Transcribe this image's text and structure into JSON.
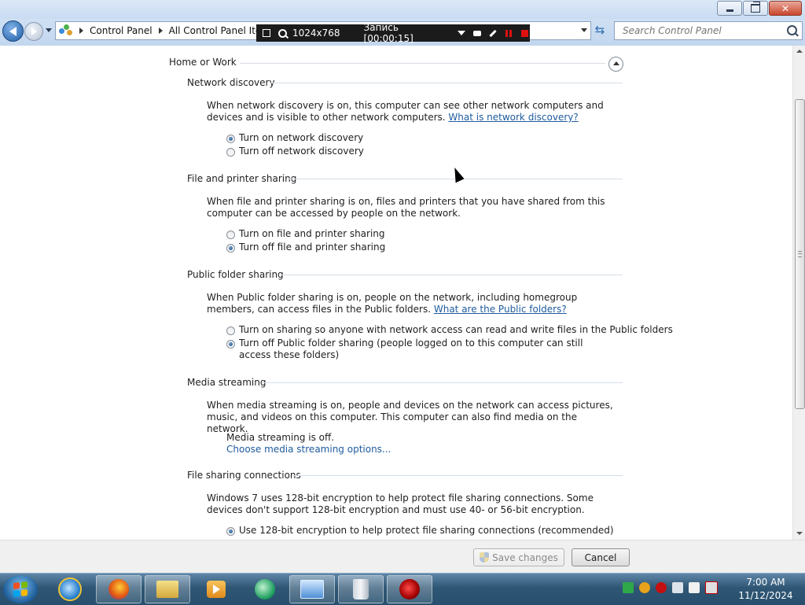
{
  "window": {
    "breadcrumb": [
      "Control Panel",
      "All Control Panel Items"
    ],
    "search_placeholder": "Search Control Panel"
  },
  "recorder": {
    "resolution": "1024x768",
    "status": "Запись [00:00:15]"
  },
  "profile": {
    "title": "Home or Work"
  },
  "sections": {
    "network_discovery": {
      "title": "Network discovery",
      "description": "When network discovery is on, this computer can see other network computers and devices and is visible to other network computers.",
      "link": "What is network discovery?",
      "options": [
        "Turn on network discovery",
        "Turn off network discovery"
      ],
      "selected": 0
    },
    "file_printer_sharing": {
      "title": "File and printer sharing",
      "description": "When file and printer sharing is on, files and printers that you have shared from this computer can be accessed by people on the network.",
      "options": [
        "Turn on file and printer sharing",
        "Turn off file and printer sharing"
      ],
      "selected": 1
    },
    "public_folder_sharing": {
      "title": "Public folder sharing",
      "description": "When Public folder sharing is on, people on the network, including homegroup members, can access files in the Public folders.",
      "link": "What are the Public folders?",
      "options": [
        "Turn on sharing so anyone with network access can read and write files in the Public folders",
        "Turn off Public folder sharing (people logged on to this computer can still access these folders)"
      ],
      "selected": 1
    },
    "media_streaming": {
      "title": "Media streaming",
      "description": "When media streaming is on, people and devices on the network can access pictures, music, and videos on this computer. This computer can also find media on the network.",
      "status": "Media streaming is off.",
      "link": "Choose media streaming options..."
    },
    "file_sharing_connections": {
      "title": "File sharing connections",
      "description": "Windows 7 uses 128-bit encryption to help protect file sharing connections. Some devices don't support 128-bit encryption and must use 40- or 56-bit encryption.",
      "options": [
        "Use 128-bit encryption to help protect file sharing connections (recommended)"
      ],
      "selected": 0
    }
  },
  "buttons": {
    "save": "Save changes",
    "cancel": "Cancel"
  },
  "taskbar": {
    "apps": [
      "internet-explorer",
      "firefox",
      "windows-explorer",
      "media-player",
      "browser-globe",
      "control-panel",
      "recycle-bin",
      "recorder"
    ],
    "clock_time": "7:00 AM",
    "clock_date": "11/12/2024"
  },
  "colors": {
    "link": "#1e5b9e",
    "taskbar": "#2f5674",
    "recorder_bg": "#1b1b1b",
    "recorder_red": "#e01010"
  }
}
